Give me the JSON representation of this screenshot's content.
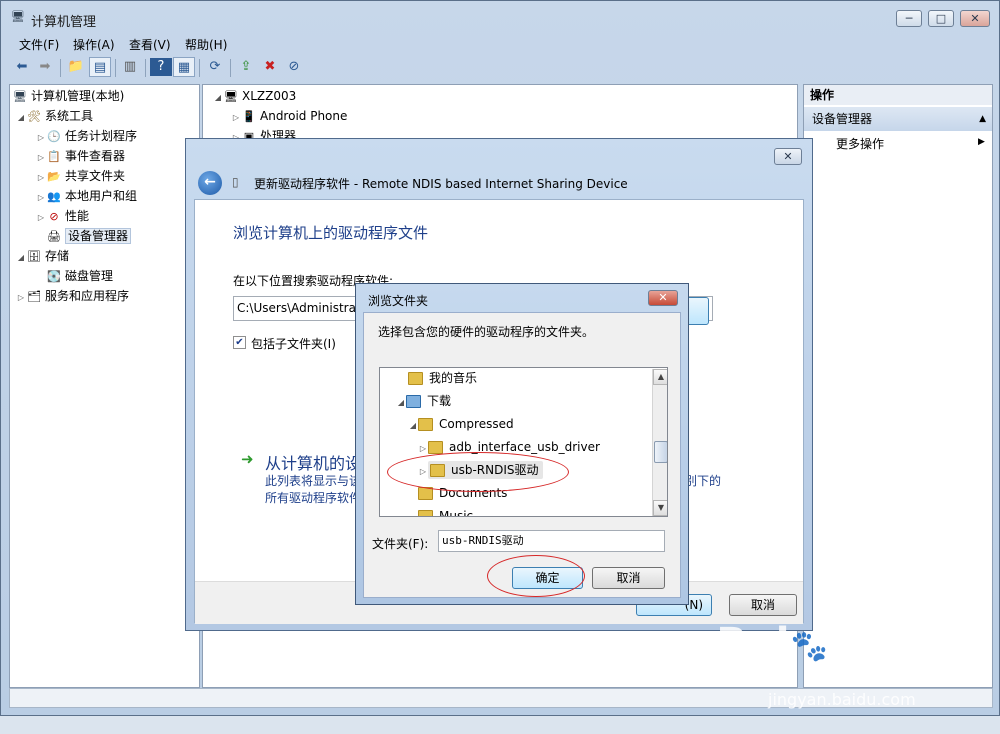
{
  "window": {
    "title": "计算机管理",
    "controls": {
      "minimize": "─",
      "maximize": "□",
      "close": "✕"
    }
  },
  "menu": [
    "文件(F)",
    "操作(A)",
    "查看(V)",
    "帮助(H)"
  ],
  "tree": {
    "root": "计算机管理(本地)",
    "system_tools": "系统工具",
    "items": [
      "任务计划程序",
      "事件查看器",
      "共享文件夹",
      "本地用户和组",
      "性能",
      "设备管理器"
    ],
    "storage": "存储",
    "disk_management": "磁盘管理",
    "services": "服务和应用程序"
  },
  "devices": {
    "computer": "XLZZ003",
    "android": "Android Phone",
    "processor": "处理器"
  },
  "actions": {
    "header": "操作",
    "device_manager": "设备管理器",
    "more": "更多操作"
  },
  "wizard": {
    "title": "更新驱动程序软件 - Remote NDIS based Internet Sharing Device",
    "heading": "浏览计算机上的驱动程序文件",
    "search_label": "在以下位置搜索驱动程序软件:",
    "path_value": "C:\\Users\\Administrat",
    "include_subfolders": "包括子文件夹(I)",
    "pick_heading": "从计算机的设",
    "pick_desc_1": "此列表将显示与该",
    "pick_desc_2": "所有驱动程序软件",
    "pick_desc_tail": "别下的",
    "next_button": "(N)",
    "cancel_button": "取消",
    "close": "✕"
  },
  "browse": {
    "title": "浏览文件夹",
    "prompt": "选择包含您的硬件的驱动程序的文件夹。",
    "folders": [
      "我的音乐",
      "下载",
      "Compressed",
      "adb_interface_usb_driver",
      "usb-RNDIS驱动",
      "Documents",
      "Music"
    ],
    "folder_label": "文件夹(F):",
    "folder_value": "usb-RNDIS驱动",
    "ok": "确定",
    "cancel": "取消",
    "close": "✕"
  },
  "watermark": {
    "logo": "Baidu经验",
    "url": "jingyan.baidu.com"
  }
}
